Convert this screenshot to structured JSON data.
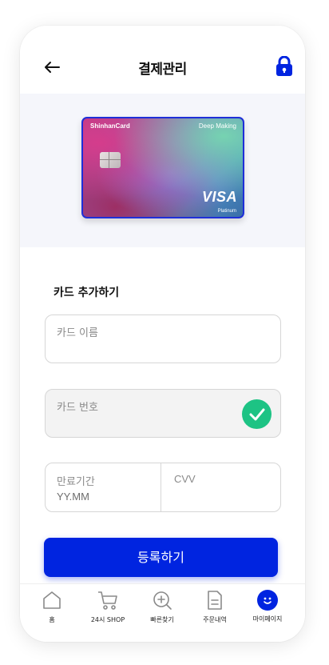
{
  "header": {
    "title": "결제관리",
    "back_icon": "arrow-left-icon",
    "lock_icon": "lock-icon"
  },
  "card": {
    "brand": "ShinhanCard",
    "product": "Deep Making",
    "network": "VISA",
    "tier": "Platinum",
    "border_color": "#1f2fd8"
  },
  "form": {
    "section_title": "카드 추가하기",
    "card_name_label": "카드 이름",
    "card_number_label": "카드 번호",
    "card_number_verified": true,
    "expiry_label": "만료기간",
    "expiry_placeholder": "YY.MM",
    "cvv_label": "CVV",
    "submit_label": "등록하기"
  },
  "tabbar": {
    "items": [
      {
        "label": "홈",
        "icon": "home-icon",
        "active": false
      },
      {
        "label": "24시 SHOP",
        "icon": "cart-icon",
        "active": false
      },
      {
        "label": "빠른찾기",
        "icon": "search-plus-icon",
        "active": false
      },
      {
        "label": "주문내역",
        "icon": "document-icon",
        "active": false
      },
      {
        "label": "마이페이지",
        "icon": "smile-icon",
        "active": true
      }
    ]
  },
  "colors": {
    "accent": "#0024e0",
    "success": "#1dc384",
    "card_area_bg": "#f5f6fb"
  }
}
